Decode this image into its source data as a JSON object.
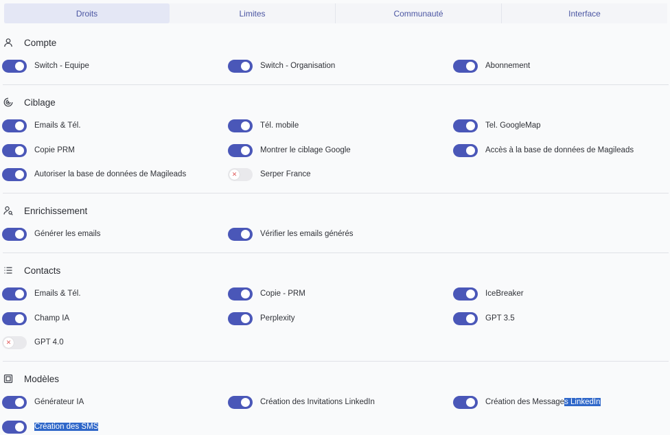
{
  "tabs": [
    {
      "label": "Droits",
      "active": true
    },
    {
      "label": "Limites",
      "active": false
    },
    {
      "label": "Communauté",
      "active": false
    },
    {
      "label": "Interface",
      "active": false
    }
  ],
  "sections": {
    "compte": {
      "title": "Compte",
      "icon": "user-icon",
      "items": [
        {
          "label": "Switch - Equipe",
          "on": true
        },
        {
          "label": "Switch - Organisation",
          "on": true
        },
        {
          "label": "Abonnement",
          "on": true
        }
      ]
    },
    "ciblage": {
      "title": "Ciblage",
      "icon": "target-icon",
      "items": [
        {
          "label": "Emails & Tél.",
          "on": true
        },
        {
          "label": "Tél. mobile",
          "on": true
        },
        {
          "label": "Tel. GoogleMap",
          "on": true
        },
        {
          "label": "Copie PRM",
          "on": true
        },
        {
          "label": "Montrer le ciblage Google",
          "on": true
        },
        {
          "label": "Accès à la base de données de Magileads",
          "on": true
        },
        {
          "label": "Autoriser la base de données de Magileads",
          "on": true
        },
        {
          "label": "Serper France",
          "on": false
        }
      ]
    },
    "enrichissement": {
      "title": "Enrichissement",
      "icon": "user-search-icon",
      "items": [
        {
          "label": "Générer les emails",
          "on": true
        },
        {
          "label": "Vérifier les emails générés",
          "on": true
        }
      ]
    },
    "contacts": {
      "title": "Contacts",
      "icon": "list-icon",
      "items": [
        {
          "label": "Emails & Tél.",
          "on": true
        },
        {
          "label": "Copie - PRM",
          "on": true
        },
        {
          "label": "IceBreaker",
          "on": true
        },
        {
          "label": "Champ IA",
          "on": true
        },
        {
          "label": "Perplexity",
          "on": true
        },
        {
          "label": "GPT 3.5",
          "on": true
        },
        {
          "label": "GPT 4.0",
          "on": false
        }
      ]
    },
    "modeles": {
      "title": "Modèles",
      "icon": "template-icon",
      "items": [
        {
          "label": "Générateur IA",
          "on": true
        },
        {
          "label": "Création des Invitations LinkedIn",
          "on": true
        },
        {
          "label_plain": "Création des Message",
          "label_selected": "s LinkedIn",
          "on": true
        },
        {
          "label": "Création des SMS",
          "on": true
        }
      ]
    }
  },
  "colors": {
    "toggle_on": "#4a57b8",
    "toggle_off": "#e9e9ec",
    "accent": "#4a55a2",
    "selection": "#2f67c9"
  }
}
